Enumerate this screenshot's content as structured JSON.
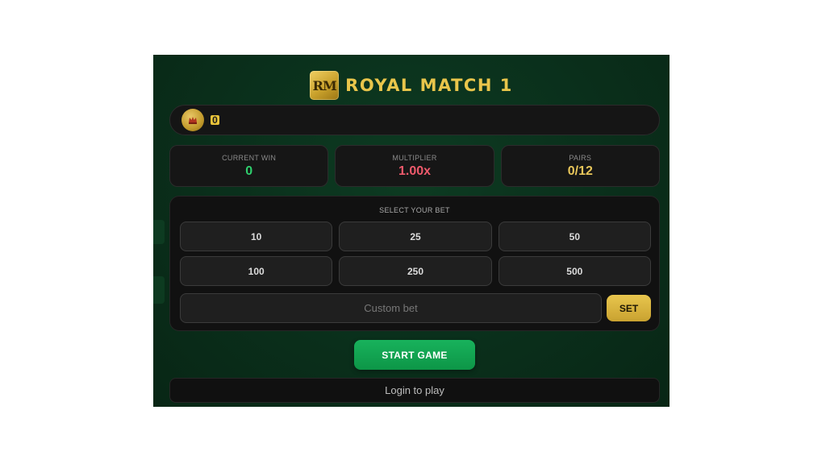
{
  "header": {
    "logo_text": "RM",
    "title": "ROYAL MATCH 1"
  },
  "balance": {
    "icon": "coin-avatar-icon",
    "value": "0"
  },
  "stats": [
    {
      "label": "CURRENT WIN",
      "value": "0",
      "color": "#2fd06e"
    },
    {
      "label": "MULTIPLIER",
      "value": "1.00x",
      "color": "#ef5a6c"
    },
    {
      "label": "PAIRS",
      "value": "0/12",
      "color": "#e8c65a"
    }
  ],
  "bet": {
    "title": "SELECT YOUR BET",
    "options": [
      "10",
      "25",
      "50",
      "100",
      "250",
      "500"
    ],
    "custom_placeholder": "Custom bet",
    "set_label": "SET"
  },
  "actions": {
    "start_label": "START GAME",
    "login_label": "Login to play"
  },
  "colors": {
    "table_green": "#0a2f1b",
    "gold": "#e9c54b",
    "start_green": "#18b25c"
  }
}
